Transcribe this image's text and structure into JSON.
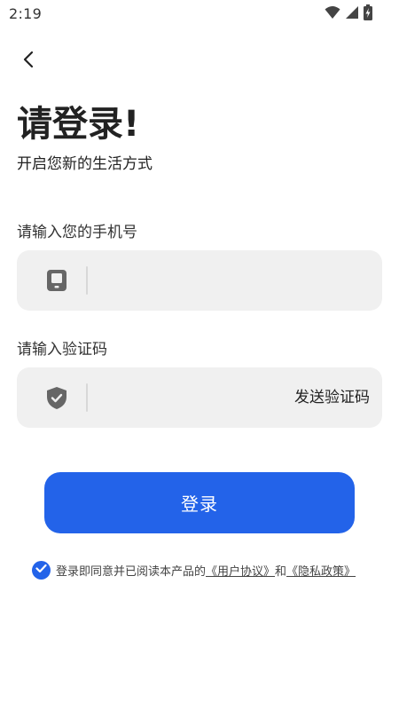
{
  "status_bar": {
    "time": "2:19",
    "icons": [
      "wifi-icon",
      "signal-icon",
      "battery-charging-icon"
    ]
  },
  "header": {
    "back_icon": "chevron-left-icon"
  },
  "title": "请登录!",
  "subtitle": "开启您新的生活方式",
  "phone_field": {
    "label": "请输入您的手机号",
    "icon": "phone-icon",
    "value": "",
    "placeholder": ""
  },
  "code_field": {
    "label": "请输入验证码",
    "icon": "shield-check-icon",
    "value": "",
    "placeholder": "",
    "send_button": "发送验证码"
  },
  "login_button": "登录",
  "agreement": {
    "checked": true,
    "prefix": "登录即同意并已阅读本产品的",
    "user_agreement": "《用户协议》",
    "conjunction": "和",
    "privacy_policy": "《隐私政策》"
  },
  "colors": {
    "accent": "#2363e9",
    "input_background": "#f0f0f0",
    "icon_gray": "#666666"
  }
}
